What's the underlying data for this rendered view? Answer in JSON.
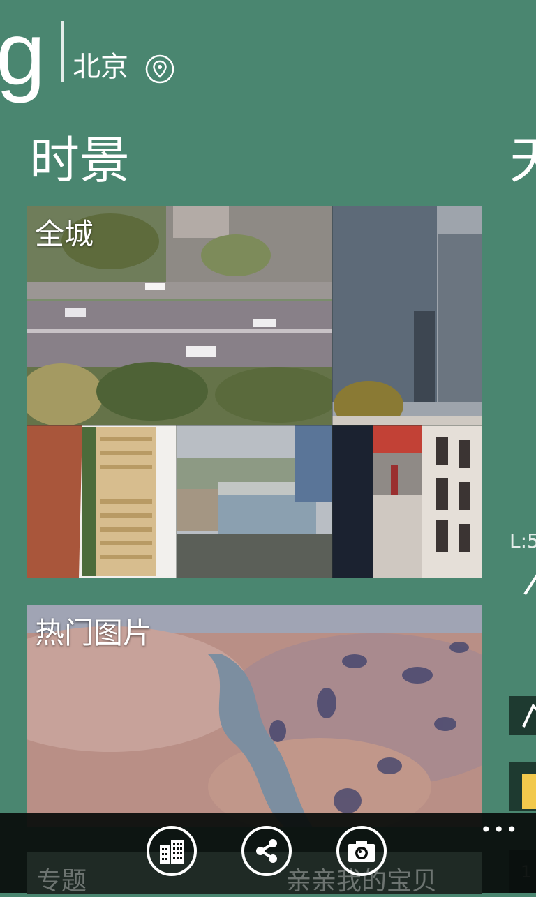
{
  "header": {
    "logo_letter": "g",
    "city": "北京",
    "location_icon": "location-pin-icon"
  },
  "section": {
    "title": "时景",
    "next_title_peek": "天"
  },
  "tiles": {
    "city_label": "全城",
    "popular_label": "热门图片"
  },
  "peek": {
    "l_text": "L:5",
    "c_text": "1"
  },
  "appbar": {
    "buttons": [
      {
        "icon": "city-buildings-icon"
      },
      {
        "icon": "share-icon"
      },
      {
        "icon": "camera-icon"
      }
    ],
    "more": "•••",
    "underlay_left": "专题",
    "underlay_right": "亲亲我的宝贝"
  }
}
